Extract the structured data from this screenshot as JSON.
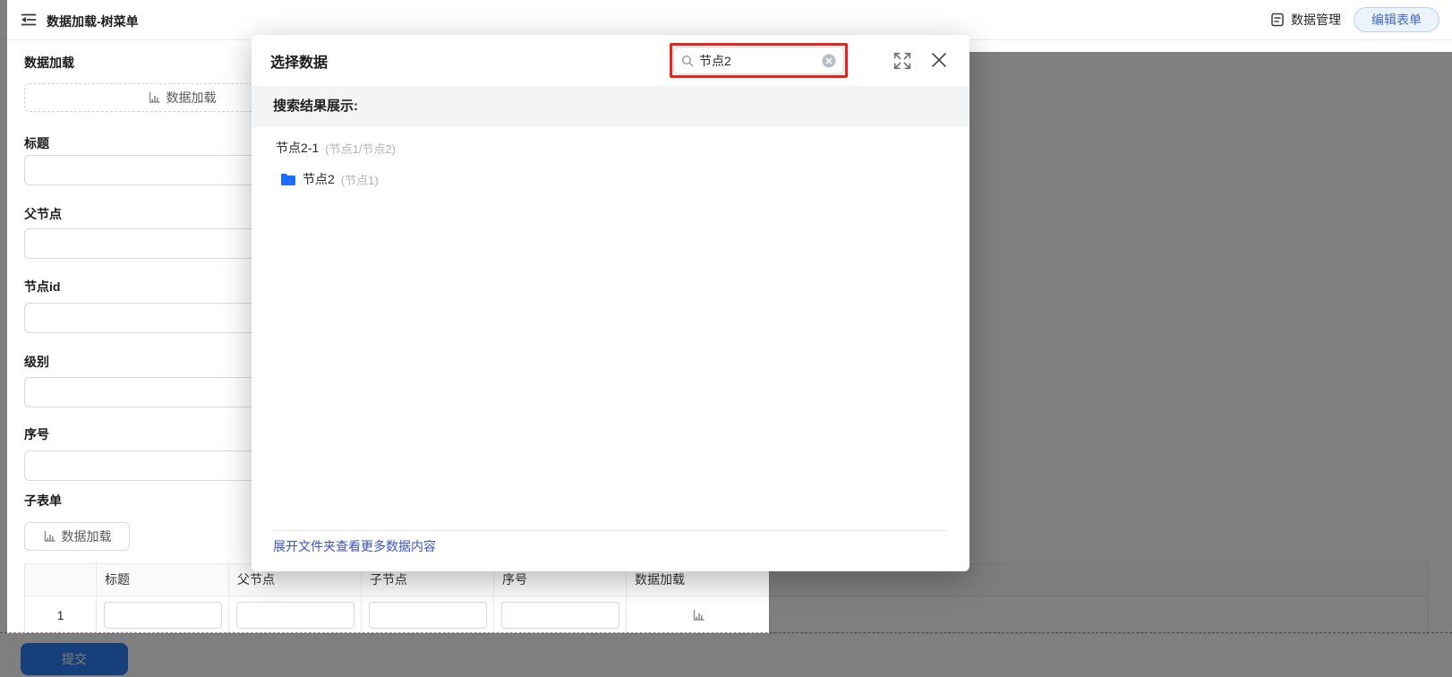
{
  "topbar": {
    "title": "数据加载-树菜单",
    "data_manage": "数据管理",
    "edit_form": "编辑表单"
  },
  "form": {
    "data_load": {
      "label": "数据加载",
      "button": "数据加载"
    },
    "fields": [
      {
        "label": "标题"
      },
      {
        "label": "父节点"
      },
      {
        "label": "节点id"
      },
      {
        "label": "级别"
      },
      {
        "label": "序号"
      }
    ],
    "subform": {
      "label": "子表单",
      "button": "数据加载"
    },
    "submit": "提交"
  },
  "subform_table": {
    "headers": [
      "标题",
      "父节点",
      "子节点",
      "序号",
      "数据加载"
    ],
    "row_index": "1"
  },
  "modal": {
    "title": "选择数据",
    "search_value": "节点2",
    "results_header": "搜索结果展示:",
    "results": [
      {
        "name": "节点2-1",
        "path": "(节点1/节点2)"
      },
      {
        "name": "节点2",
        "path": "(节点1)"
      }
    ],
    "footer_link": "展开文件夹查看更多数据内容"
  },
  "colors": {
    "accent_blue": "#2f80f7",
    "highlight_red": "#e8251d",
    "link_blue": "#3d53c1",
    "folder_blue": "#1a6dff",
    "edit_pill_text": "#4169c9"
  }
}
